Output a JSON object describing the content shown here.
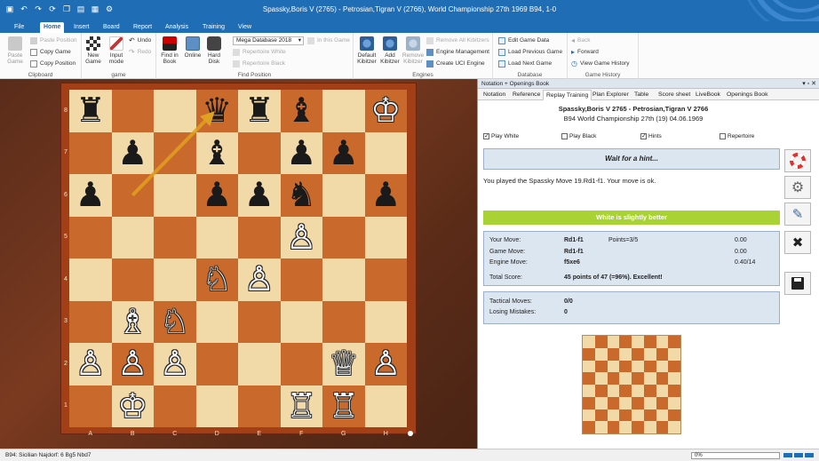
{
  "window": {
    "title": "Spassky,Boris V (2765) - Petrosian,Tigran V (2766), World Championship 27th 1969  B94, 1-0"
  },
  "tabs": [
    "File",
    "Home",
    "Insert",
    "Board",
    "Report",
    "Analysis",
    "Training",
    "View"
  ],
  "ribbon": {
    "clipboard": {
      "caption": "Clipboard",
      "paste_game": "Paste Game",
      "paste_position": "Paste Position",
      "copy_game": "Copy Game",
      "copy_position": "Copy Position"
    },
    "game": {
      "caption": "game",
      "new_game": "New Game",
      "input_mode": "Input mode",
      "undo": "Undo",
      "redo": "Redo"
    },
    "find_position": {
      "caption": "Find Position",
      "find_in_book": "Find in Book",
      "online": "Online",
      "hard_disk": "Hard Disk",
      "database_value": "Mega Database 2018",
      "in_this_game": "In this Game",
      "repertoire_white": "Repertoire White",
      "repertoire_black": "Repertoire Black"
    },
    "engines": {
      "caption": "Engines",
      "default_kibitzer": "Default Kibitzer",
      "add_kibitzer": "Add Kibitzer",
      "remove_kibitzer": "Remove Kibitzer",
      "remove_all": "Remove All Kibitzers",
      "engine_management": "Engine Management",
      "create_uci": "Create UCI Engine"
    },
    "database": {
      "caption": "Database",
      "edit_game_data": "Edit Game Data",
      "load_previous": "Load Previous Game",
      "load_next": "Load Next Game"
    },
    "history": {
      "caption": "Game History",
      "back": "Back",
      "forward": "Forward",
      "view_history": "View Game History"
    }
  },
  "board": {
    "files": [
      "A",
      "B",
      "C",
      "D",
      "E",
      "F",
      "G",
      "H"
    ],
    "ranks": [
      "8",
      "7",
      "6",
      "5",
      "4",
      "3",
      "2",
      "1"
    ],
    "pieces": [
      {
        "sq": "a8",
        "glyph": "♜",
        "color": "b"
      },
      {
        "sq": "d8",
        "glyph": "♛",
        "color": "b"
      },
      {
        "sq": "e8",
        "glyph": "♜",
        "color": "b"
      },
      {
        "sq": "f8",
        "glyph": "♝",
        "color": "b"
      },
      {
        "sq": "h8",
        "glyph": "♔",
        "color": "w"
      },
      {
        "sq": "b7",
        "glyph": "♟",
        "color": "b"
      },
      {
        "sq": "d7",
        "glyph": "♝",
        "color": "b"
      },
      {
        "sq": "f7",
        "glyph": "♟",
        "color": "b"
      },
      {
        "sq": "g7",
        "glyph": "♟",
        "color": "b"
      },
      {
        "sq": "a6",
        "glyph": "♟",
        "color": "b"
      },
      {
        "sq": "d6",
        "glyph": "♟",
        "color": "b"
      },
      {
        "sq": "e6",
        "glyph": "♟",
        "color": "b"
      },
      {
        "sq": "f6",
        "glyph": "♞",
        "color": "b"
      },
      {
        "sq": "h6",
        "glyph": "♟",
        "color": "b"
      },
      {
        "sq": "f5",
        "glyph": "♙",
        "color": "w"
      },
      {
        "sq": "d4",
        "glyph": "♘",
        "color": "w"
      },
      {
        "sq": "e4",
        "glyph": "♙",
        "color": "w"
      },
      {
        "sq": "b3",
        "glyph": "♗",
        "color": "w"
      },
      {
        "sq": "c3",
        "glyph": "♘",
        "color": "w"
      },
      {
        "sq": "a2",
        "glyph": "♙",
        "color": "w"
      },
      {
        "sq": "b2",
        "glyph": "♙",
        "color": "w"
      },
      {
        "sq": "c2",
        "glyph": "♙",
        "color": "w"
      },
      {
        "sq": "g2",
        "glyph": "♕",
        "color": "w"
      },
      {
        "sq": "h2",
        "glyph": "♙",
        "color": "w"
      },
      {
        "sq": "b1",
        "glyph": "♔",
        "color": "w"
      },
      {
        "sq": "f1",
        "glyph": "♖",
        "color": "w"
      },
      {
        "sq": "g1",
        "glyph": "♖",
        "color": "w"
      }
    ],
    "arrow": {
      "from": "b6",
      "to": "d8",
      "color": "#e0a020"
    }
  },
  "panel": {
    "header": "Notation + Openings Book",
    "tabs": [
      "Notation",
      "Reference",
      "Replay Training",
      "Plan Explorer",
      "Table",
      "Score sheet",
      "LiveBook",
      "Openings Book"
    ],
    "active_tab": "Replay Training",
    "game_line1": "Spassky,Boris V 2765 - Petrosian,Tigran V 2766",
    "game_line2": "B94 World Championship 27th (19) 04.06.1969",
    "checks": {
      "play_white": "Play White",
      "play_black": "Play Black",
      "hints": "Hints",
      "repertoire": "Repertoire"
    },
    "check_mark": "✓",
    "hint_button": "Wait for a hint...",
    "message": "You played the Spassky Move 19.Rd1-f1. Your move is ok.",
    "evaluation": "White is slightly better",
    "stats": {
      "your_move_label": "Your Move:",
      "your_move": "Rd1-f1",
      "points": "Points=3/5",
      "your_score": "0.00",
      "game_move_label": "Game Move:",
      "game_move": "Rd1-f1",
      "game_score": "0.00",
      "engine_move_label": "Engine Move:",
      "engine_move": "f5xe6",
      "engine_score": "0.40/14",
      "total_label": "Total Score:",
      "total": "45 points of 47 (=96%). Excellent!"
    },
    "mistakes": {
      "tactical_label": "Tactical Moves:",
      "tactical": "0/0",
      "losing_label": "Losing Mistakes:",
      "losing": "0"
    }
  },
  "status": {
    "opening": "B94: Sicilian Najdorf: 6 Bg5 Nbd7",
    "progress": "0%"
  },
  "colors": {
    "accent": "#1f6db5",
    "eval_green": "#a9d235",
    "board_light": "#f1d9a8",
    "board_dark": "#c96a2c"
  }
}
